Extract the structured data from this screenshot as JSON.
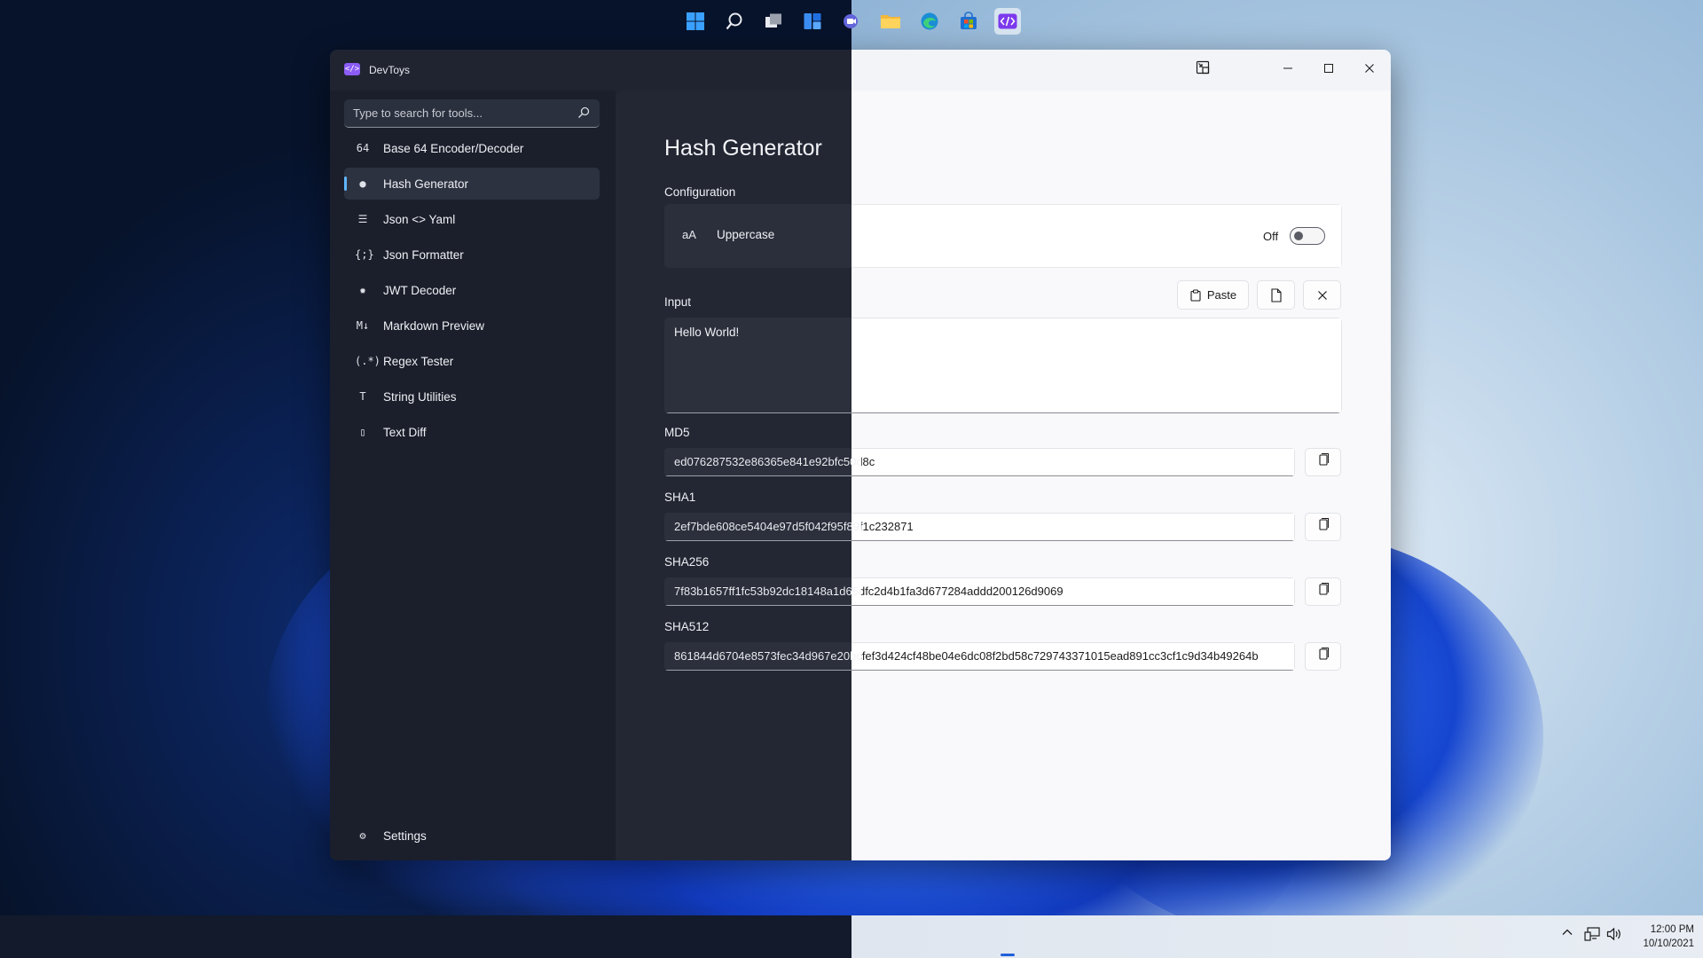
{
  "app": {
    "title": "DevToys",
    "logo": "</>"
  },
  "search": {
    "placeholder": "Type to search for tools..."
  },
  "sidebar": {
    "items": [
      {
        "label": "Base 64 Encoder/Decoder",
        "icon": "base64-icon",
        "glyph": "64"
      },
      {
        "label": "Hash Generator",
        "icon": "hash-icon",
        "glyph": "●",
        "selected": true
      },
      {
        "label": "Json <> Yaml",
        "icon": "json-yaml-icon",
        "glyph": "☰"
      },
      {
        "label": "Json Formatter",
        "icon": "json-formatter-icon",
        "glyph": "{;}"
      },
      {
        "label": "JWT Decoder",
        "icon": "jwt-icon",
        "glyph": "✹"
      },
      {
        "label": "Markdown Preview",
        "icon": "markdown-icon",
        "glyph": "M↓"
      },
      {
        "label": "Regex Tester",
        "icon": "regex-icon",
        "glyph": "(.*)"
      },
      {
        "label": "String Utilities",
        "icon": "text-icon",
        "glyph": "T"
      },
      {
        "label": "Text Diff",
        "icon": "diff-icon",
        "glyph": "▯"
      }
    ],
    "settings_label": "Settings"
  },
  "page": {
    "title": "Hash Generator",
    "configuration_label": "Configuration",
    "uppercase": {
      "icon_text": "aA",
      "label": "Uppercase",
      "state_label": "Off",
      "on": false
    },
    "input": {
      "label": "Input",
      "value": "Hello World!",
      "paste_label": "Paste"
    },
    "hashes": [
      {
        "label": "MD5",
        "value": "ed076287532e86365e841e92bfc50d8c"
      },
      {
        "label": "SHA1",
        "value": "2ef7bde608ce5404e97d5f042f95f89f1c232871"
      },
      {
        "label": "SHA256",
        "value": "7f83b1657ff1fc53b92dc18148a1d65dfc2d4b1fa3d677284addd200126d9069"
      },
      {
        "label": "SHA512",
        "value": "861844d6704e8573fec34d967e20bcfef3d424cf48be04e6dc08f2bd58c729743371015ead891cc3cf1c9d34b49264b"
      }
    ]
  },
  "taskbar": {
    "icons": [
      "start-icon",
      "search-icon",
      "task-view-icon",
      "widgets-icon",
      "chat-icon",
      "explorer-icon",
      "edge-icon",
      "store-icon",
      "devtoys-icon"
    ],
    "time": "12:00 PM",
    "date": "10/10/2021"
  },
  "colors": {
    "accent": "#60b6ff",
    "dark_surface": "#202431",
    "light_surface": "#f9f9fb",
    "devtoys_purple": "#8b5cf6"
  }
}
